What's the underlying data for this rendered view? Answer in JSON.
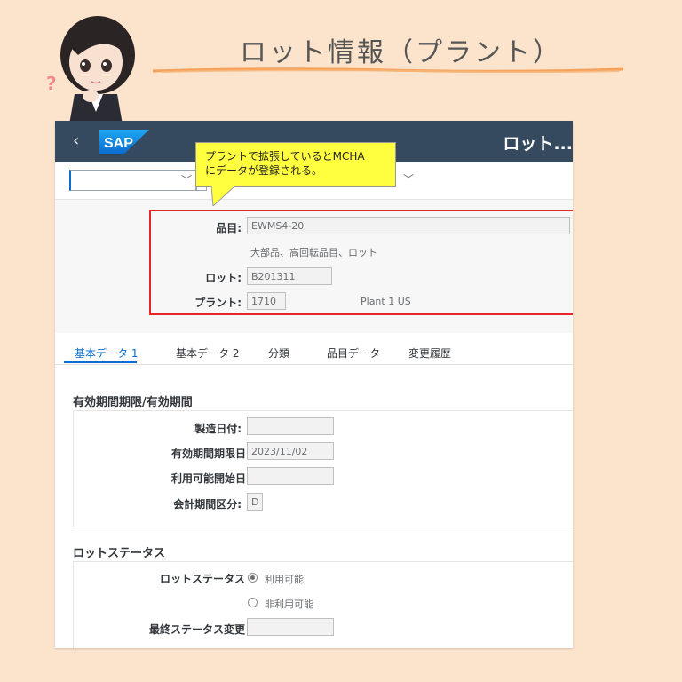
{
  "banner": {
    "title": "ロット情報（プラント）"
  },
  "colors": {
    "shellbar": "#354a5f",
    "accent": "#0a6ed1",
    "highlight_box": "#e8252a",
    "callout_bg": "#ffff40",
    "background": "#fbe3cc"
  },
  "shell": {
    "back_icon": "‹",
    "logo_text": "SAP",
    "title": "ロット..."
  },
  "callout": {
    "line1": "プラントで拡張しているとMCHA",
    "line2": "にデータが登録される。"
  },
  "header": {
    "material_label": "品目:",
    "material_value": "EWMS4-20",
    "material_desc": "大部品、高回転品目、ロット",
    "batch_label": "ロット:",
    "batch_value": "B201311",
    "plant_label": "プラント:",
    "plant_value": "1710",
    "plant_name": "Plant 1 US"
  },
  "tabs": [
    {
      "label": "基本データ 1",
      "active": true
    },
    {
      "label": "基本データ 2"
    },
    {
      "label": "分類"
    },
    {
      "label": "品目データ"
    },
    {
      "label": "変更履歴"
    }
  ],
  "shelf_life": {
    "title": "有効期間期限/有効期間",
    "mfg_date_label": "製造日付:",
    "mfg_date_value": "",
    "sled_label": "有効期間期限日",
    "sled_value": "2023/11/02",
    "avail_label": "利用可能開始日",
    "avail_value": "",
    "period_label": "会計期間区分:",
    "period_value": "D"
  },
  "status": {
    "title": "ロットステータス",
    "status_label": "ロットステータス",
    "option_available": "利用可能",
    "option_unavailable": "非利用可能",
    "last_change_label": "最終ステータス変更",
    "last_change_value": ""
  }
}
